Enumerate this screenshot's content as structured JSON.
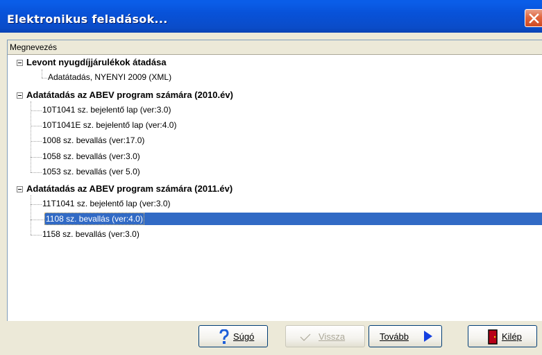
{
  "window": {
    "title": "Elektronikus feladások..."
  },
  "list": {
    "column_header": "Megnevezés",
    "groups": [
      {
        "label": "Levont nyugdíjjárulékok átadása",
        "items": [
          "Adatátadás, NYENYI 2009 (XML)"
        ]
      },
      {
        "label": "Adatátadás az ABEV program számára (2010.év)",
        "items": [
          "10T1041 sz. bejelentő lap (ver:3.0)",
          "10T1041E sz. bejelentő lap (ver:4.0)",
          "1008 sz. bevallás (ver:17.0)",
          "1058 sz. bevallás (ver:3.0)",
          "1053 sz. bevallás (ver 5.0)"
        ]
      },
      {
        "label": "Adatátadás az ABEV program számára (2011.év)",
        "items": [
          "11T1041 sz. bejelentő lap (ver:3.0)",
          "1108 sz. bevallás (ver:4.0)",
          "1158 sz. bevallás (ver:3.0)"
        ]
      }
    ],
    "selected_item": "1108 sz. bevallás (ver:4.0)"
  },
  "buttons": {
    "help": "Súgó",
    "back": "Vissza",
    "next": "Tovább",
    "exit": "Kilép"
  },
  "colors": {
    "titlebar": "#0A4CC8",
    "selection": "#316AC5",
    "close": "#E1663E"
  },
  "icons": {
    "help": "question-mark-icon",
    "back": "check-mark-icon",
    "next": "arrow-right-icon",
    "exit": "door-exit-icon",
    "close": "close-icon"
  }
}
